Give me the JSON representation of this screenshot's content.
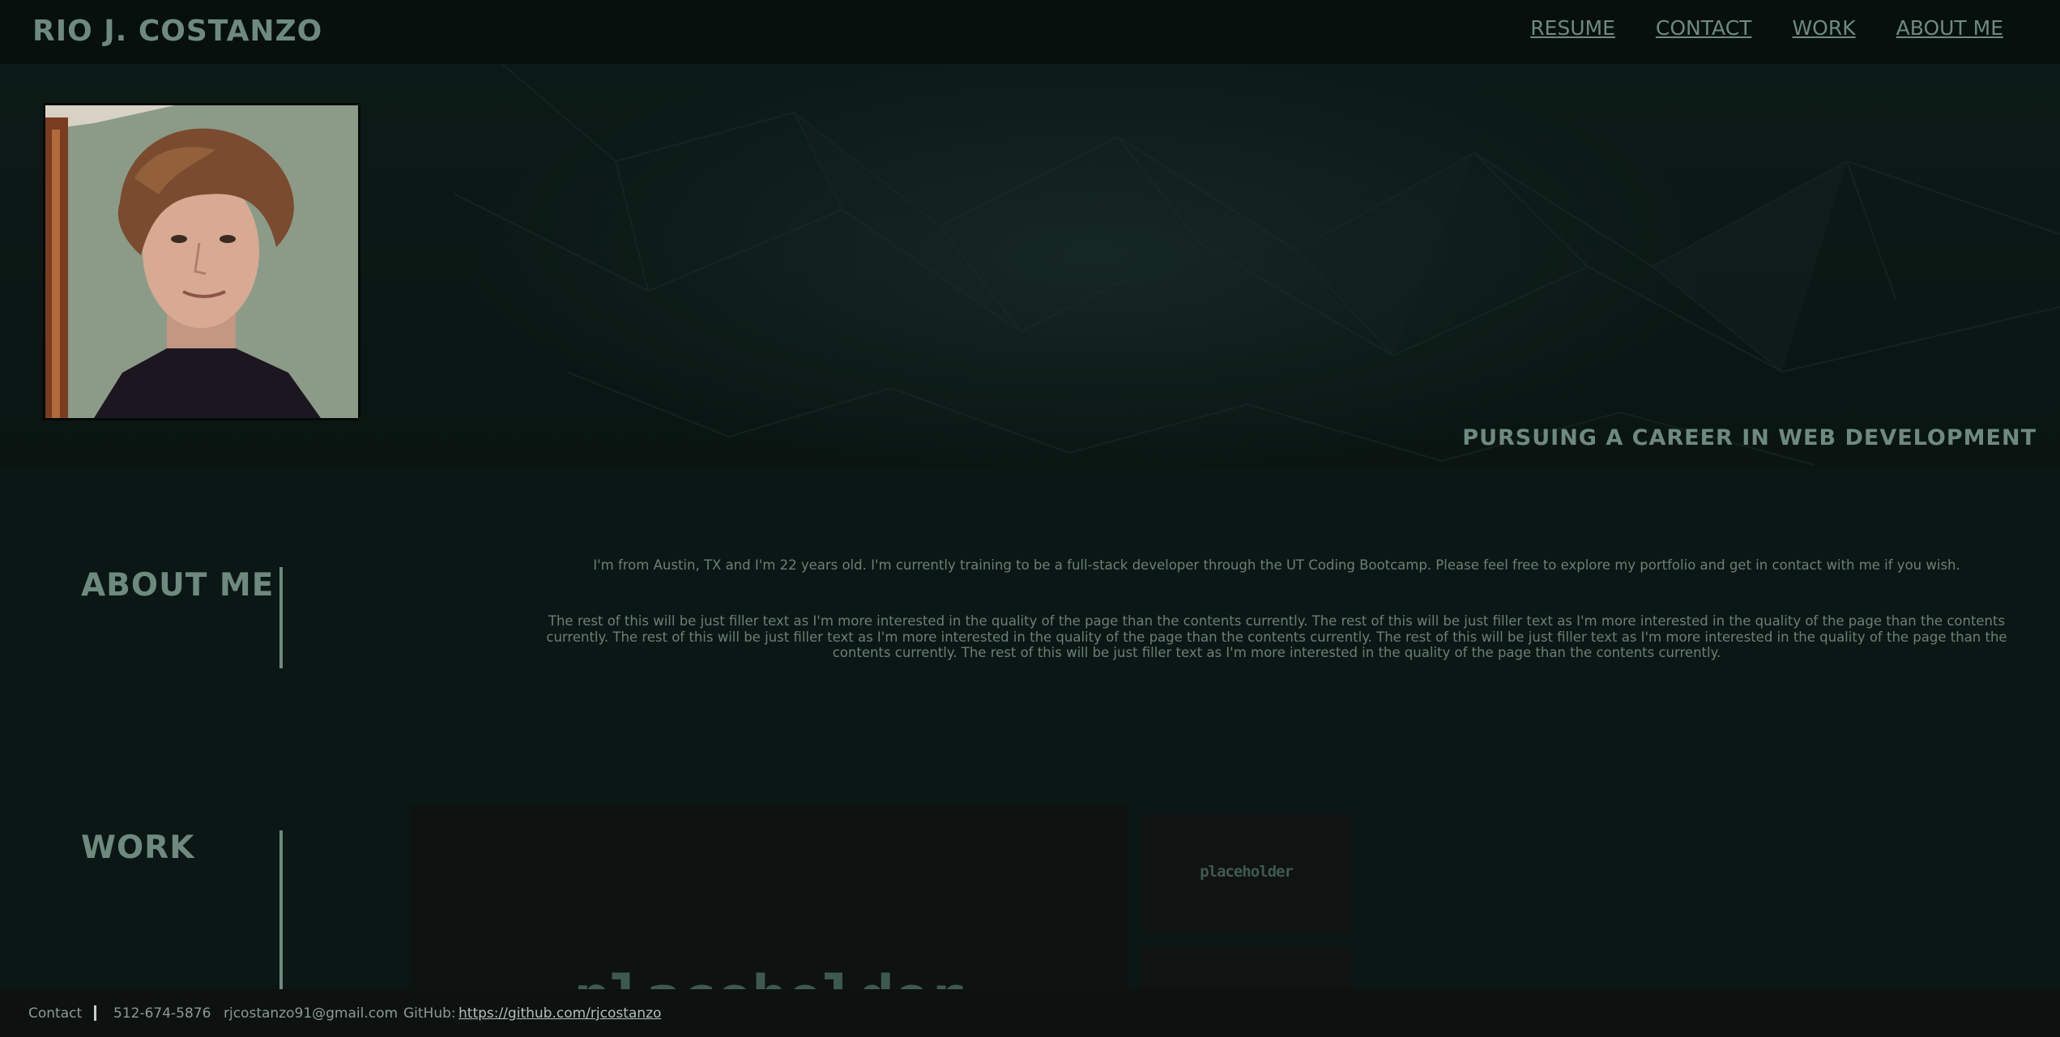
{
  "header": {
    "site_title": "RIO J. COSTANZO",
    "nav": [
      {
        "label": "RESUME"
      },
      {
        "label": "CONTACT"
      },
      {
        "label": "WORK"
      },
      {
        "label": "ABOUT ME"
      }
    ]
  },
  "hero": {
    "tagline": "PURSUING A CAREER IN WEB DEVELOPMENT"
  },
  "about": {
    "title": "ABOUT ME",
    "paragraph_1": "I'm from Austin, TX and I'm 22 years old. I'm currently training to be a full-stack developer through the UT Coding Bootcamp. Please feel free to explore my portfolio and get in contact with me if you wish.",
    "paragraph_2": "The rest of this will be just filler text as I'm more interested in the quality of the page than the contents currently. The rest of this will be just filler text as I'm more interested in the quality of the page than the contents currently. The rest of this will be just filler text as I'm more interested in the quality of the page than the contents currently. The rest of this will be just filler text as I'm more interested in the quality of the page than the contents currently. The rest of this will be just filler text as I'm more interested in the quality of the page than the contents currently."
  },
  "work": {
    "title": "WORK",
    "main_placeholder": "placeholder",
    "thumb_placeholder": "placeholder"
  },
  "footer": {
    "contact_label": "Contact",
    "phone": "512-674-5876",
    "email": "rjcostanzo91@gmail.com",
    "github_label": "GitHub:",
    "github_link": "https://github.com/rjcostanzo"
  }
}
